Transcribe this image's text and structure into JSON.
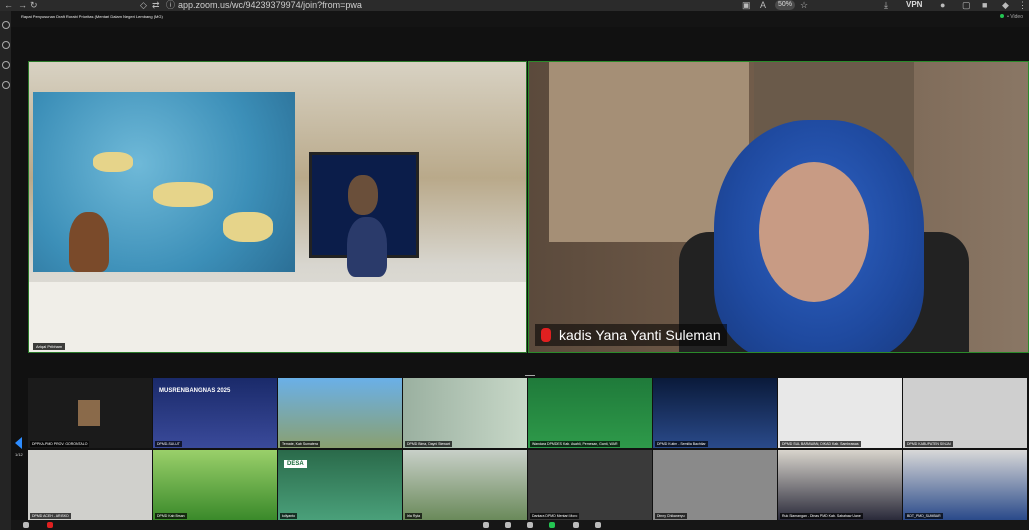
{
  "browser": {
    "url": "app.zoom.us/wc/94239379974/join?from=pwa",
    "zoom": "50%",
    "vpn": "VPN"
  },
  "meeting": {
    "title": "Rapat Penyusunan Draft Rorabi Prioritas (Mentari Dalam Negeri Lembang (MG)",
    "status": "• Video",
    "main_tiles": [
      {
        "name": "Ariqal Pribham"
      },
      {
        "name": "kadis Yana Yanti Suleman"
      }
    ],
    "page": "1/12",
    "grid": [
      {
        "name": "DPPKA-PMD PROV. GORONTALO"
      },
      {
        "name": "DPMD-SULUT",
        "caption": "MUSRENBANGNAS 2025"
      },
      {
        "name": "Ternate, Kab Sumatera"
      },
      {
        "name": "DPMD Bima, Dayni Stewart"
      },
      {
        "name": "Wandara DPMDES Kab. Asahli, Pemesan, Ganti, WAR"
      },
      {
        "name": "DPMD Kutim - Semilia Bachtiar"
      },
      {
        "name": "DPMD SUL BARAWAN, DIKAD Kab. Sambrawas"
      },
      {
        "name": "DPMD KABUPATEN SINJAI"
      },
      {
        "name": "DPMD ACEH - ARISKD"
      },
      {
        "name": "DPMD Kab Brsan"
      },
      {
        "name": "kdlyanto",
        "caption": "DESA"
      },
      {
        "name": "Irla Ryta"
      },
      {
        "name": "Dantara DPMD Mentari Moro"
      },
      {
        "name": "Dinny Chikaneryu"
      },
      {
        "name": "Ruk Slamangan - Dinas PMD Kab. Sabahaw Uane"
      },
      {
        "name": "BDT_PMD_SUMBAR"
      }
    ]
  }
}
